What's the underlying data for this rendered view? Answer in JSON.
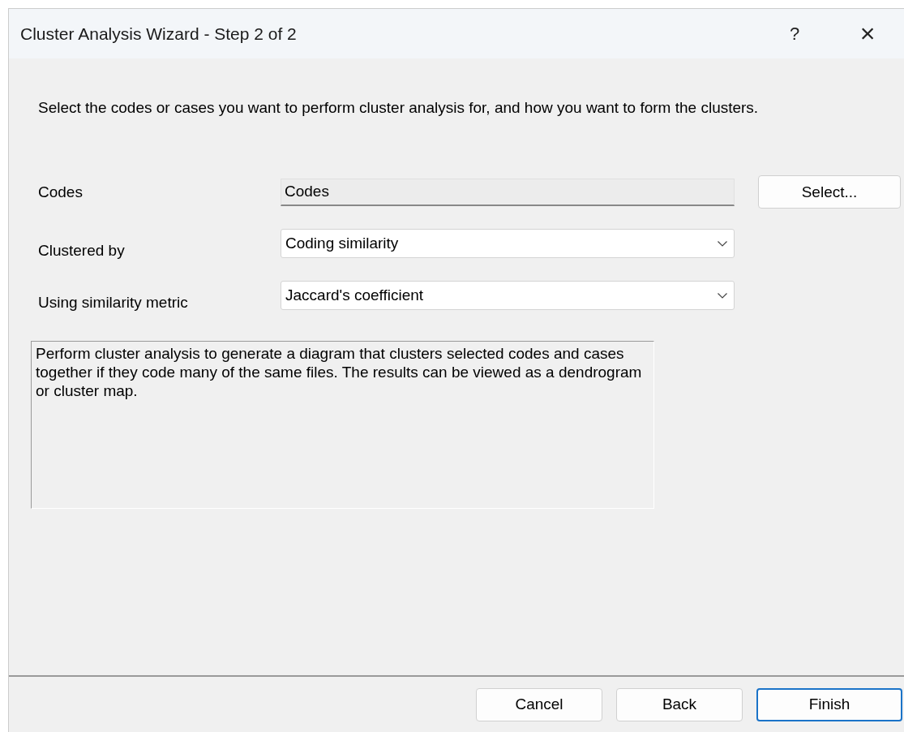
{
  "window": {
    "title": "Cluster Analysis Wizard - Step 2 of 2",
    "help": "?",
    "close": "×"
  },
  "instruction": "Select the codes or cases you want to perform cluster analysis for, and how you want to form the clusters.",
  "fields": [
    {
      "kind": "readonly",
      "label": "Codes",
      "value": "Codes",
      "button": "Select..."
    },
    {
      "kind": "dropdown",
      "label": "Clustered by",
      "value": "Coding similarity"
    },
    {
      "kind": "dropdown",
      "label": "Using similarity metric",
      "value": "Jaccard's coefficient"
    }
  ],
  "description": "Perform cluster analysis to generate a diagram that clusters selected codes and cases together if they code many of the same files. The results can be viewed as a dendrogram or cluster map.",
  "buttons": [
    {
      "label": "Cancel",
      "default": false
    },
    {
      "label": "Back",
      "default": false
    },
    {
      "label": "Finish",
      "default": true
    }
  ]
}
